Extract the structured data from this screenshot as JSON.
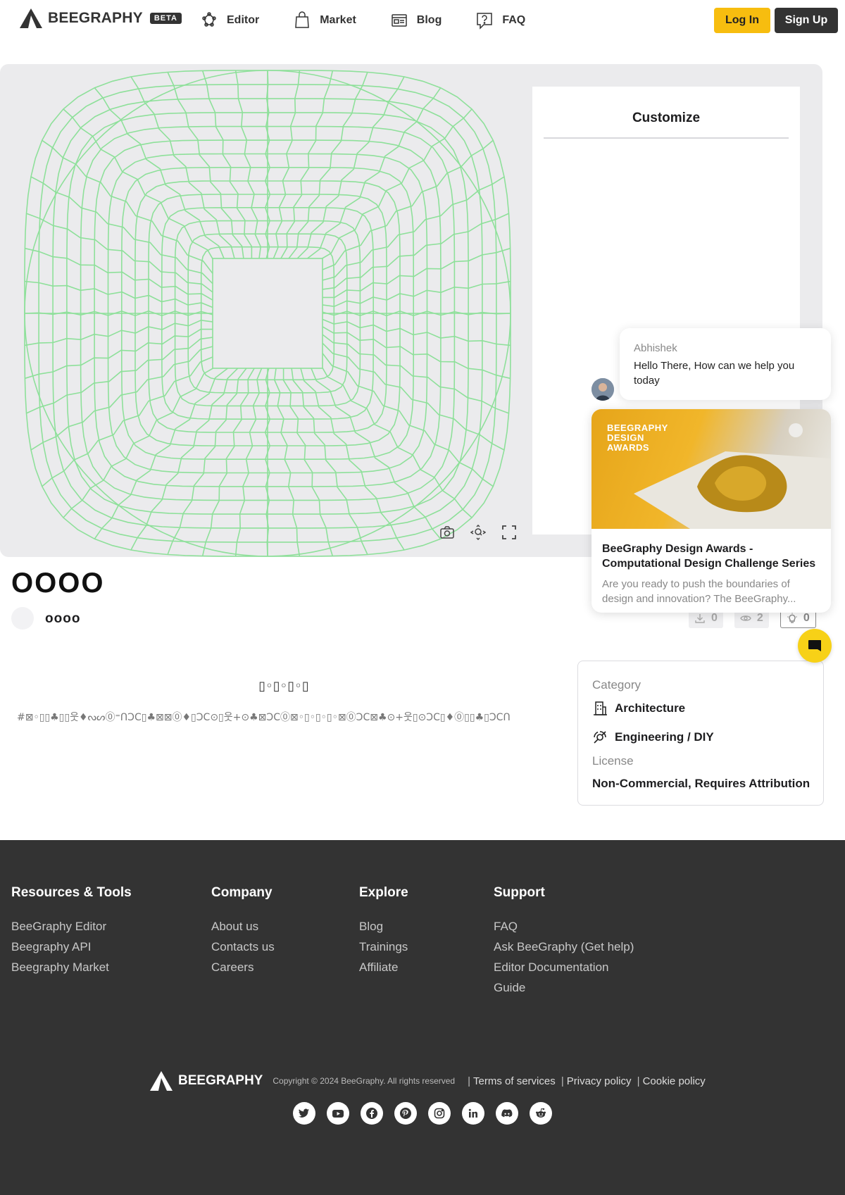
{
  "header": {
    "logo_text": "BEEGRAPHY",
    "beta_badge": "BETA",
    "nav": [
      {
        "label": "Editor",
        "icon": "editor-icon"
      },
      {
        "label": "Market",
        "icon": "shopping-bag-icon"
      },
      {
        "label": "Blog",
        "icon": "newspaper-icon"
      },
      {
        "label": "FAQ",
        "icon": "question-icon"
      }
    ],
    "login_label": "Log In",
    "signup_label": "Sign Up"
  },
  "viewer": {
    "mesh_color": "#8ee09a",
    "customize_title": "Customize",
    "tools": [
      "screenshot-icon",
      "zoom-fit-icon",
      "fullscreen-icon"
    ]
  },
  "model": {
    "title": "OOOO",
    "author": "oooo",
    "downloads": "0",
    "views": "2",
    "likes": "0"
  },
  "description": {
    "heading": "▯◦▯◦▯◦▯",
    "text": "#⊠◦▯▯♣▯▯웃♦ᔓᔕ⓪⁼ᑎↃϹ▯♣⊠⊠⓪♦▯ↃϹ⊙▯웃+⊙♣⊠ↃϹ⓪⊠◦▯◦▯◦▯◦⊠⓪ↃϹ⊠♣⊙+웃▯⊙ↃϹ▯♦⓪▯▯♣▯ↃϹᑎ"
  },
  "info": {
    "category_label": "Category",
    "categories": [
      "Architecture",
      "Engineering / DIY"
    ],
    "license_label": "License",
    "license_value": "Non-Commercial, Requires Attribution"
  },
  "chat": {
    "sender": "Abhishek",
    "message": "Hello There, How can we help you today",
    "promo_image_text": [
      "BEEGRAPHY",
      "DESIGN",
      "AWARDS"
    ],
    "promo_title": "BeeGraphy Design Awards - Computational Design Challenge Series",
    "promo_text": "Are you ready to push the boundaries of design and innovation? The BeeGraphy...",
    "accent": "#f7d117"
  },
  "footer": {
    "columns": [
      {
        "title": "Resources & Tools",
        "links": [
          "BeeGraphy Editor",
          "Beegraphy API",
          "Beegraphy Market"
        ]
      },
      {
        "title": "Company",
        "links": [
          "About us",
          "Contacts us",
          "Careers"
        ]
      },
      {
        "title": "Explore",
        "links": [
          "Blog",
          "Trainings",
          "Affiliate"
        ]
      },
      {
        "title": "Support",
        "links": [
          "FAQ",
          "Ask BeeGraphy (Get help)",
          "Editor Documentation",
          "Guide"
        ]
      }
    ],
    "logo_text": "BEEGRAPHY",
    "copyright": "Copyright © 2024 BeeGraphy. All rights reserved",
    "legal": [
      "Terms of services",
      "Privacy policy",
      "Cookie policy"
    ],
    "socials": [
      "twitter-icon",
      "youtube-icon",
      "facebook-icon",
      "pinterest-icon",
      "instagram-icon",
      "linkedin-icon",
      "discord-icon",
      "reddit-icon"
    ],
    "background": "#333333"
  },
  "colors": {
    "brand_yellow": "#f7bd0f",
    "dark": "#333333"
  }
}
